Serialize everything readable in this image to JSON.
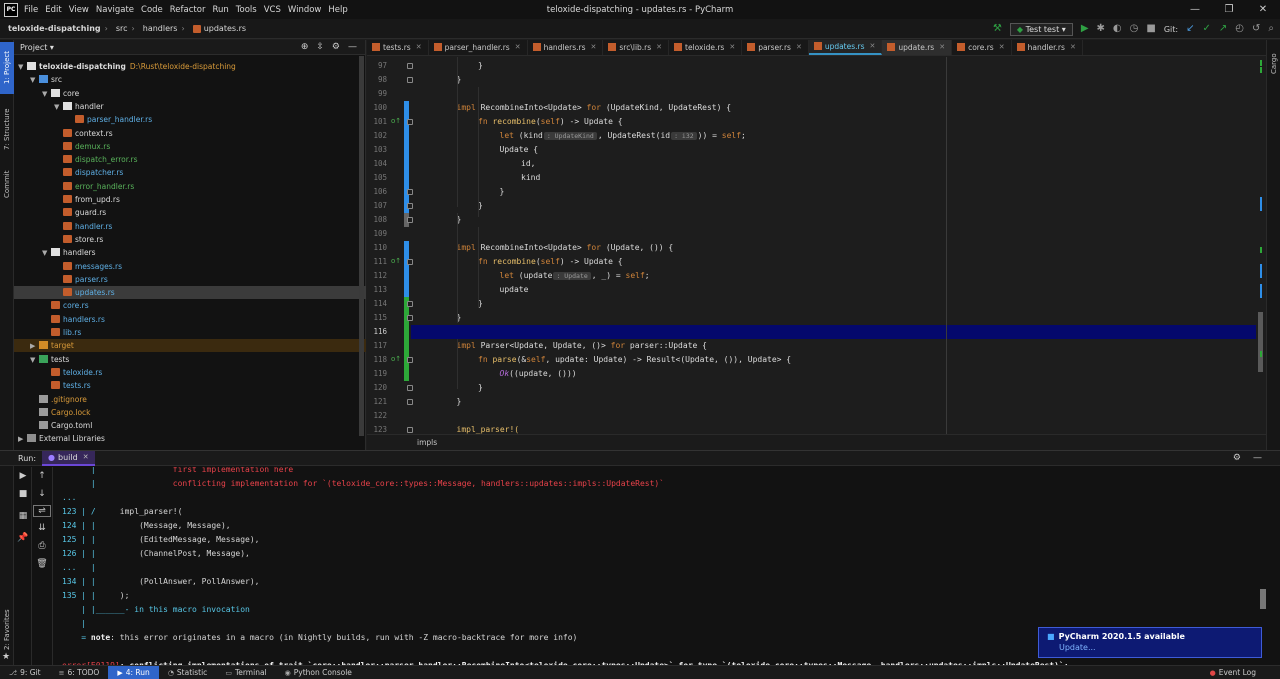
{
  "menu": {
    "logo": "PC",
    "items": [
      "File",
      "Edit",
      "View",
      "Navigate",
      "Code",
      "Refactor",
      "Run",
      "Tools",
      "VCS",
      "Window",
      "Help"
    ],
    "title": "teloxide-dispatching - updates.rs - PyCharm"
  },
  "nav": {
    "crumbs": [
      "teloxide-dispatching",
      "src",
      "handlers",
      "updates.rs"
    ],
    "run_config": "Test test",
    "git_label": "Git:"
  },
  "left_strip": {
    "project": "1: Project",
    "structure": "7: Structure",
    "commit": "Commit",
    "favorites": "2: Favorites"
  },
  "right_strip": {
    "cargo": "Cargo"
  },
  "project": {
    "title": "Project",
    "tree": [
      {
        "label": "teloxide-dispatching",
        "extra": "D:\\Rust\\teloxide-dispatching",
        "depth": 0,
        "kind": "folder",
        "open": true,
        "color": "white",
        "bold": true
      },
      {
        "label": "src",
        "depth": 1,
        "kind": "folder-blue",
        "open": true,
        "color": "white"
      },
      {
        "label": "core",
        "depth": 2,
        "kind": "folder",
        "open": true,
        "color": "white"
      },
      {
        "label": "handler",
        "depth": 3,
        "kind": "folder",
        "open": true,
        "color": "white"
      },
      {
        "label": "parser_handler.rs",
        "depth": 4,
        "kind": "rs",
        "color": "blue"
      },
      {
        "label": "context.rs",
        "depth": 3,
        "kind": "rs",
        "color": "white"
      },
      {
        "label": "demux.rs",
        "depth": 3,
        "kind": "rs",
        "color": "green"
      },
      {
        "label": "dispatch_error.rs",
        "depth": 3,
        "kind": "rs",
        "color": "green"
      },
      {
        "label": "dispatcher.rs",
        "depth": 3,
        "kind": "rs",
        "color": "blue"
      },
      {
        "label": "error_handler.rs",
        "depth": 3,
        "kind": "rs",
        "color": "green"
      },
      {
        "label": "from_upd.rs",
        "depth": 3,
        "kind": "rs",
        "color": "white"
      },
      {
        "label": "guard.rs",
        "depth": 3,
        "kind": "rs",
        "color": "white"
      },
      {
        "label": "handler.rs",
        "depth": 3,
        "kind": "rs",
        "color": "blue"
      },
      {
        "label": "store.rs",
        "depth": 3,
        "kind": "rs",
        "color": "white"
      },
      {
        "label": "handlers",
        "depth": 2,
        "kind": "folder",
        "open": true,
        "color": "white"
      },
      {
        "label": "messages.rs",
        "depth": 3,
        "kind": "rs",
        "color": "blue"
      },
      {
        "label": "parser.rs",
        "depth": 3,
        "kind": "rs",
        "color": "blue"
      },
      {
        "label": "updates.rs",
        "depth": 3,
        "kind": "rs",
        "color": "blue",
        "selected": true
      },
      {
        "label": "core.rs",
        "depth": 2,
        "kind": "rs",
        "color": "blue"
      },
      {
        "label": "handlers.rs",
        "depth": 2,
        "kind": "rs",
        "color": "blue"
      },
      {
        "label": "lib.rs",
        "depth": 2,
        "kind": "rs",
        "color": "blue"
      },
      {
        "label": "target",
        "depth": 1,
        "kind": "folder-orange",
        "open": false,
        "color": "orange",
        "target": true
      },
      {
        "label": "tests",
        "depth": 1,
        "kind": "folder-green",
        "open": true,
        "color": "white"
      },
      {
        "label": "teloxide.rs",
        "depth": 2,
        "kind": "rs",
        "color": "blue"
      },
      {
        "label": "tests.rs",
        "depth": 2,
        "kind": "rs",
        "color": "blue"
      },
      {
        "label": ".gitignore",
        "depth": 1,
        "kind": "txt",
        "color": "orange"
      },
      {
        "label": "Cargo.lock",
        "depth": 1,
        "kind": "txt",
        "color": "orange"
      },
      {
        "label": "Cargo.toml",
        "depth": 1,
        "kind": "txt",
        "color": "white"
      },
      {
        "label": "External Libraries",
        "depth": 0,
        "kind": "lib",
        "open": false,
        "color": "white"
      }
    ]
  },
  "editor": {
    "tabs": [
      {
        "label": "tests.rs"
      },
      {
        "label": "parser_handler.rs"
      },
      {
        "label": "handlers.rs"
      },
      {
        "label": "src\\lib.rs"
      },
      {
        "label": "teloxide.rs"
      },
      {
        "label": "parser.rs"
      },
      {
        "label": "updates.rs",
        "active": true
      },
      {
        "label": "update.rs",
        "current": true
      },
      {
        "label": "core.rs"
      },
      {
        "label": "handler.rs"
      }
    ],
    "lines": [
      {
        "n": "97",
        "indent": 2,
        "parts": [
          [
            "}",
            ""
          ]
        ]
      },
      {
        "n": "98",
        "indent": 1,
        "parts": [
          [
            "}",
            ""
          ]
        ]
      },
      {
        "n": "99",
        "indent": 0,
        "parts": []
      },
      {
        "n": "100",
        "indent": 1,
        "parts": [
          [
            "impl",
            "kw"
          ],
          [
            " RecombineInto<Update> ",
            ""
          ],
          [
            "for",
            "kw"
          ],
          [
            " (UpdateKind, UpdateRest) {",
            ""
          ]
        ]
      },
      {
        "n": "101",
        "indent": 2,
        "icon": "o↑",
        "parts": [
          [
            "fn",
            "kw"
          ],
          [
            " ",
            ""
          ],
          [
            "recombine",
            "fn"
          ],
          [
            "(",
            ""
          ],
          [
            "self",
            "kw"
          ],
          [
            ") -> Update {",
            ""
          ]
        ]
      },
      {
        "n": "102",
        "indent": 3,
        "parts": [
          [
            "let",
            "kw"
          ],
          [
            " (kind",
            ""
          ],
          [
            ": UpdateKind",
            "hint"
          ],
          [
            ", UpdateRest(id",
            ""
          ],
          [
            ": i32",
            "hint"
          ],
          [
            ")) = ",
            ""
          ],
          [
            "self",
            "kw"
          ],
          [
            ";",
            ""
          ]
        ]
      },
      {
        "n": "103",
        "indent": 3,
        "parts": [
          [
            "Update {",
            ""
          ]
        ]
      },
      {
        "n": "104",
        "indent": 4,
        "parts": [
          [
            "id,",
            ""
          ]
        ]
      },
      {
        "n": "105",
        "indent": 4,
        "parts": [
          [
            "kind",
            ""
          ]
        ]
      },
      {
        "n": "106",
        "indent": 3,
        "parts": [
          [
            "}",
            ""
          ]
        ]
      },
      {
        "n": "107",
        "indent": 2,
        "parts": [
          [
            "}",
            ""
          ]
        ]
      },
      {
        "n": "108",
        "indent": 1,
        "parts": [
          [
            "}",
            ""
          ]
        ]
      },
      {
        "n": "109",
        "indent": 0,
        "parts": []
      },
      {
        "n": "110",
        "indent": 1,
        "parts": [
          [
            "impl",
            "kw"
          ],
          [
            " RecombineInto<Update> ",
            ""
          ],
          [
            "for",
            "kw"
          ],
          [
            " (Update, ()) {",
            ""
          ]
        ]
      },
      {
        "n": "111",
        "indent": 2,
        "icon": "o↑",
        "parts": [
          [
            "fn",
            "kw"
          ],
          [
            " ",
            ""
          ],
          [
            "recombine",
            "fn"
          ],
          [
            "(",
            ""
          ],
          [
            "self",
            "kw"
          ],
          [
            ") -> Update {",
            ""
          ]
        ]
      },
      {
        "n": "112",
        "indent": 3,
        "parts": [
          [
            "let",
            "kw"
          ],
          [
            " (update",
            ""
          ],
          [
            ": Update",
            "hint"
          ],
          [
            ", _) = ",
            ""
          ],
          [
            "self",
            "kw"
          ],
          [
            ";",
            ""
          ]
        ]
      },
      {
        "n": "113",
        "indent": 3,
        "parts": [
          [
            "update",
            ""
          ]
        ]
      },
      {
        "n": "114",
        "indent": 2,
        "parts": [
          [
            "}",
            ""
          ]
        ]
      },
      {
        "n": "115",
        "indent": 1,
        "parts": [
          [
            "}",
            ""
          ]
        ]
      },
      {
        "n": "116",
        "indent": 0,
        "current": true,
        "parts": []
      },
      {
        "n": "117",
        "indent": 1,
        "parts": [
          [
            "impl",
            "kw"
          ],
          [
            " Parser<Update, Update, ()> ",
            ""
          ],
          [
            "for",
            "kw"
          ],
          [
            " parser::Update {",
            ""
          ]
        ]
      },
      {
        "n": "118",
        "indent": 2,
        "icon": "o↑",
        "parts": [
          [
            "fn",
            "kw"
          ],
          [
            " ",
            ""
          ],
          [
            "parse",
            "fn"
          ],
          [
            "(&",
            ""
          ],
          [
            "self",
            "kw"
          ],
          [
            ", update: Update) -> Result<(Update, ()), Update> {",
            ""
          ]
        ]
      },
      {
        "n": "119",
        "indent": 3,
        "parts": [
          [
            "Ok",
            "mac"
          ],
          [
            "((update, ()))",
            ""
          ]
        ]
      },
      {
        "n": "120",
        "indent": 2,
        "parts": [
          [
            "}",
            ""
          ]
        ]
      },
      {
        "n": "121",
        "indent": 1,
        "parts": [
          [
            "}",
            ""
          ]
        ]
      },
      {
        "n": "122",
        "indent": 0,
        "parts": []
      },
      {
        "n": "123",
        "indent": 1,
        "parts": [
          [
            "impl_parser!(",
            "fn"
          ]
        ]
      }
    ],
    "breadcrumb": "impls"
  },
  "run": {
    "label": "Run:",
    "tab": "build",
    "output": [
      {
        "parts": [
          [
            "      |                ",
            "cyan"
          ],
          [
            "first implementation here",
            "red"
          ]
        ]
      },
      {
        "parts": [
          [
            "      |                ",
            "cyan"
          ],
          [
            "conflicting implementation for `(teloxide_core::types::Message, handlers::updates::impls::UpdateRest)`",
            "red"
          ]
        ]
      },
      {
        "parts": [
          [
            "...",
            "cyan"
          ]
        ]
      },
      {
        "parts": [
          [
            "123 | /",
            "cyan"
          ],
          [
            "     impl_parser!(",
            ""
          ]
        ]
      },
      {
        "parts": [
          [
            "124 | |",
            "cyan"
          ],
          [
            "         (Message, Message),",
            ""
          ]
        ]
      },
      {
        "parts": [
          [
            "125 | |",
            "cyan"
          ],
          [
            "         (EditedMessage, Message),",
            ""
          ]
        ]
      },
      {
        "parts": [
          [
            "126 | |",
            "cyan"
          ],
          [
            "         (ChannelPost, Message),",
            ""
          ]
        ]
      },
      {
        "parts": [
          [
            "...   |",
            "cyan"
          ]
        ]
      },
      {
        "parts": [
          [
            "134 | |",
            "cyan"
          ],
          [
            "         (PollAnswer, PollAnswer),",
            ""
          ]
        ]
      },
      {
        "parts": [
          [
            "135 | |",
            "cyan"
          ],
          [
            "     );",
            ""
          ]
        ]
      },
      {
        "parts": [
          [
            "    | |______- in this macro invocation",
            "cyan"
          ]
        ]
      },
      {
        "parts": [
          [
            "    |",
            "cyan"
          ]
        ]
      },
      {
        "parts": [
          [
            "    = ",
            "cyan"
          ],
          [
            "note",
            "bold"
          ],
          [
            ": this error originates in a macro (in Nightly builds, run with -Z macro-backtrace for more info)",
            ""
          ]
        ]
      },
      {
        "parts": []
      },
      {
        "parts": [
          [
            "error[E0119]",
            "red"
          ],
          [
            ": conflicting implementations of trait `core::handler::parser_handler::RecombineInto<teloxide_core::types::Update>` for type `(teloxide_core::types::Message, handlers::updates::impls::UpdateRest)`:",
            "bold"
          ]
        ]
      }
    ]
  },
  "notification": {
    "title": "PyCharm 2020.1.5 available",
    "link": "Update..."
  },
  "statusbar": {
    "items": [
      {
        "icon": "⎇",
        "label": "9: Git"
      },
      {
        "icon": "≡",
        "label": "6: TODO"
      },
      {
        "icon": "▶",
        "label": "4: Run",
        "active": true
      },
      {
        "icon": "◔",
        "label": "Statistic"
      },
      {
        "icon": "▭",
        "label": "Terminal"
      },
      {
        "icon": "◉",
        "label": "Python Console"
      }
    ],
    "event_log": "Event Log"
  }
}
